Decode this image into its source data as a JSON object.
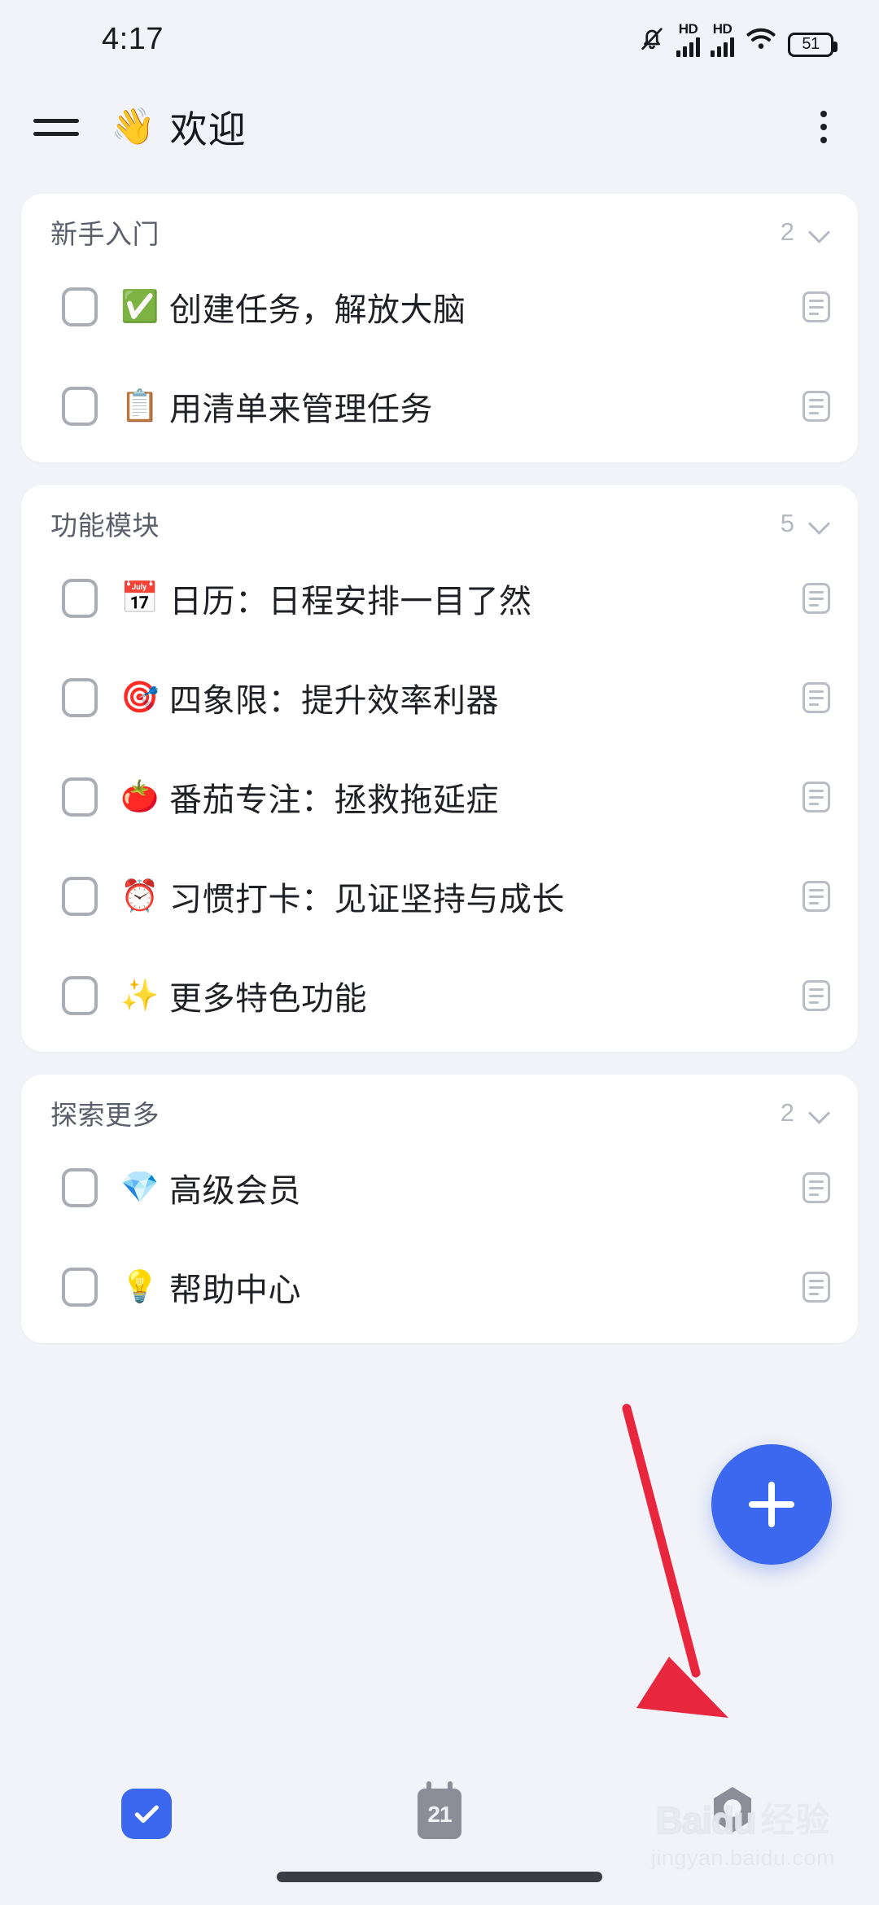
{
  "statusbar": {
    "time": "4:17",
    "mute_icon": "bell-off-icon",
    "hd_label_1": "HD",
    "hd_label_2": "HD",
    "wifi_icon": "wifi-icon",
    "battery_level": "51"
  },
  "appbar": {
    "menu_icon": "hamburger-menu-icon",
    "title_emoji": "👋",
    "title": "欢迎",
    "overflow_icon": "more-vertical-icon"
  },
  "groups": [
    {
      "title": "新手入门",
      "count": "2",
      "chevron": "chevron-down-icon",
      "tasks": [
        {
          "emoji": "✅",
          "label": "创建任务，解放大脑",
          "note_icon": "note-icon"
        },
        {
          "emoji": "📋",
          "label": "用清单来管理任务",
          "note_icon": "note-icon"
        }
      ]
    },
    {
      "title": "功能模块",
      "count": "5",
      "chevron": "chevron-down-icon",
      "tasks": [
        {
          "emoji": "📅",
          "label": "日历：日程安排一目了然",
          "note_icon": "note-icon"
        },
        {
          "emoji": "🎯",
          "label": "四象限：提升效率利器",
          "note_icon": "note-icon"
        },
        {
          "emoji": "🍅",
          "label": "番茄专注：拯救拖延症",
          "note_icon": "note-icon"
        },
        {
          "emoji": "⏰",
          "label": "习惯打卡：见证坚持与成长",
          "note_icon": "note-icon"
        },
        {
          "emoji": "✨",
          "label": "更多特色功能",
          "note_icon": "note-icon"
        }
      ]
    },
    {
      "title": "探索更多",
      "count": "2",
      "chevron": "chevron-down-icon",
      "tasks": [
        {
          "emoji": "💎",
          "label": "高级会员",
          "note_icon": "note-icon"
        },
        {
          "emoji": "💡",
          "label": "帮助中心",
          "note_icon": "note-icon"
        }
      ]
    }
  ],
  "fab": {
    "icon": "plus-icon",
    "color": "#3b68ef"
  },
  "annotation": {
    "arrow_color": "#e8273f",
    "points_to": "fab-add-button"
  },
  "bottomnav": {
    "tabs": [
      {
        "icon": "checkbox-check-icon",
        "active": "true"
      },
      {
        "icon": "calendar-icon",
        "day": "21",
        "active": "false"
      },
      {
        "icon": "rocket-icon",
        "active": "false"
      }
    ]
  },
  "watermark": {
    "brand": "Baidu",
    "brand_cn": "经验",
    "url": "jingyan.baidu.com"
  }
}
